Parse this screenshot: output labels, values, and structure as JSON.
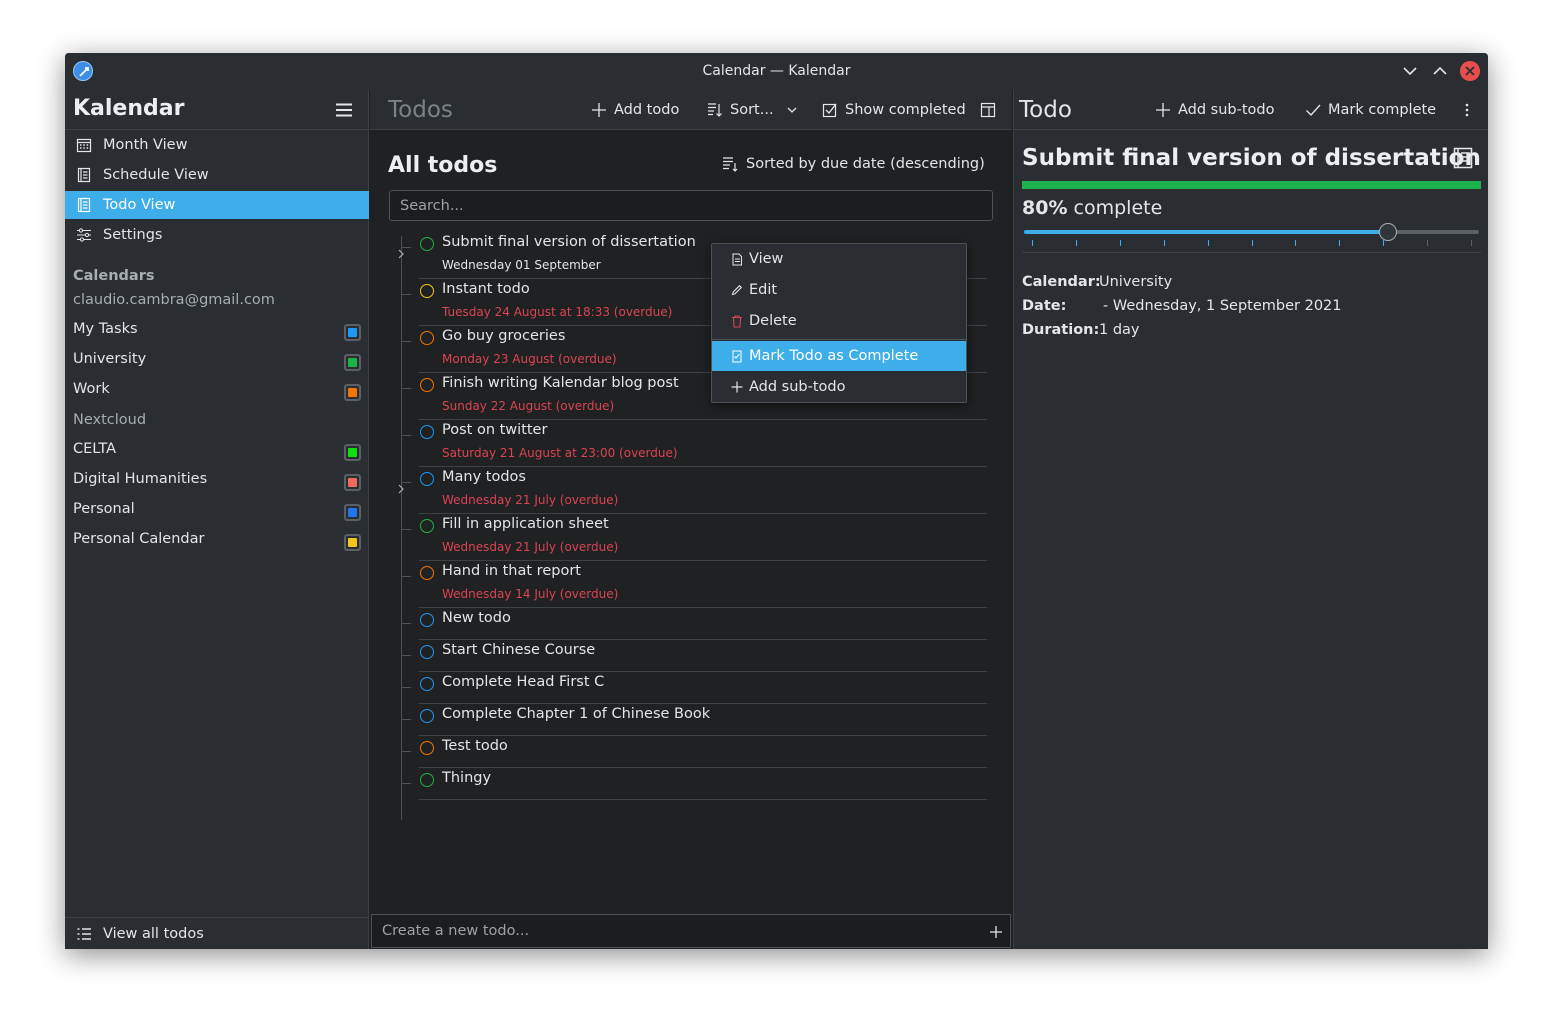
{
  "window": {
    "title": "Calendar — Kalendar"
  },
  "sidebar": {
    "title": "Kalendar",
    "nav": [
      {
        "label": "Month View",
        "icon": "calendar-month-icon"
      },
      {
        "label": "Schedule View",
        "icon": "schedule-icon"
      },
      {
        "label": "Todo View",
        "icon": "todo-list-icon",
        "active": true
      },
      {
        "label": "Settings",
        "icon": "settings-icon"
      }
    ],
    "calendars_heading": "Calendars",
    "account": "claudio.cambra@gmail.com",
    "calendars_a": [
      {
        "label": "My Tasks",
        "color": "#1d99f3"
      },
      {
        "label": "University",
        "color": "#1cb447"
      },
      {
        "label": "Work",
        "color": "#f67400"
      }
    ],
    "nextcloud": "Nextcloud",
    "calendars_b": [
      {
        "label": "CELTA",
        "color": "#10e010"
      },
      {
        "label": "Digital Humanities",
        "color": "#ef6a58"
      },
      {
        "label": "Personal",
        "color": "#2276ef"
      },
      {
        "label": "Personal Calendar",
        "color": "#f4c51a"
      }
    ],
    "footer": "View all todos"
  },
  "center": {
    "title": "Todos",
    "add_todo": "Add todo",
    "sort": "Sort...",
    "show_completed": "Show completed",
    "heading": "All todos",
    "sorted_by": "Sorted by due date (descending)",
    "search_placeholder": "Search...",
    "new_todo_placeholder": "Create a new todo...",
    "todos": [
      {
        "name": "Submit final version of dissertation",
        "date": "Wednesday 01 September",
        "overdue": false,
        "color": "#1cb447",
        "expandable": true
      },
      {
        "name": "Instant todo",
        "date": "Tuesday 24 August at 18:33 (overdue)",
        "overdue": true,
        "color": "#f4c51a"
      },
      {
        "name": "Go buy groceries",
        "date": "Monday 23 August (overdue)",
        "overdue": true,
        "color": "#f67400"
      },
      {
        "name": "Finish writing Kalendar blog post",
        "date": "Sunday 22 August (overdue)",
        "overdue": true,
        "color": "#f67400"
      },
      {
        "name": "Post on twitter",
        "date": "Saturday 21 August at 23:00 (overdue)",
        "overdue": true,
        "color": "#1d99f3"
      },
      {
        "name": "Many todos",
        "date": "Wednesday 21 July (overdue)",
        "overdue": true,
        "color": "#1d99f3",
        "expandable": true
      },
      {
        "name": "Fill in application sheet",
        "date": "Wednesday 21 July (overdue)",
        "overdue": true,
        "color": "#1cb447"
      },
      {
        "name": "Hand in that report",
        "date": "Wednesday 14 July (overdue)",
        "overdue": true,
        "color": "#f67400"
      },
      {
        "name": "New todo",
        "date": "",
        "color": "#1d99f3"
      },
      {
        "name": "Start Chinese Course",
        "date": "",
        "color": "#1d99f3"
      },
      {
        "name": "Complete Head First C",
        "date": "",
        "color": "#1d99f3"
      },
      {
        "name": "Complete Chapter 1 of Chinese Book",
        "date": "",
        "color": "#1d99f3"
      },
      {
        "name": "Test todo",
        "date": "",
        "color": "#f67400"
      },
      {
        "name": "Thingy",
        "date": "",
        "color": "#1cb447"
      }
    ]
  },
  "context_menu": {
    "view": "View",
    "edit": "Edit",
    "delete": "Delete",
    "mark_complete": "Mark Todo as Complete",
    "add_subtodo": "Add sub-todo"
  },
  "detail": {
    "header": "Todo",
    "add_subtodo": "Add sub-todo",
    "mark_complete": "Mark complete",
    "title": "Submit final version of dissertation",
    "percent": "80%",
    "percent_suffix": "complete",
    "progress_fraction": 0.8,
    "calendar_label": "Calendar:",
    "calendar_value": "University",
    "date_label": "Date:",
    "date_value": "- Wednesday, 1 September 2021",
    "duration_label": "Duration:",
    "duration_value": "1 day",
    "accent": "#1bb34d"
  }
}
